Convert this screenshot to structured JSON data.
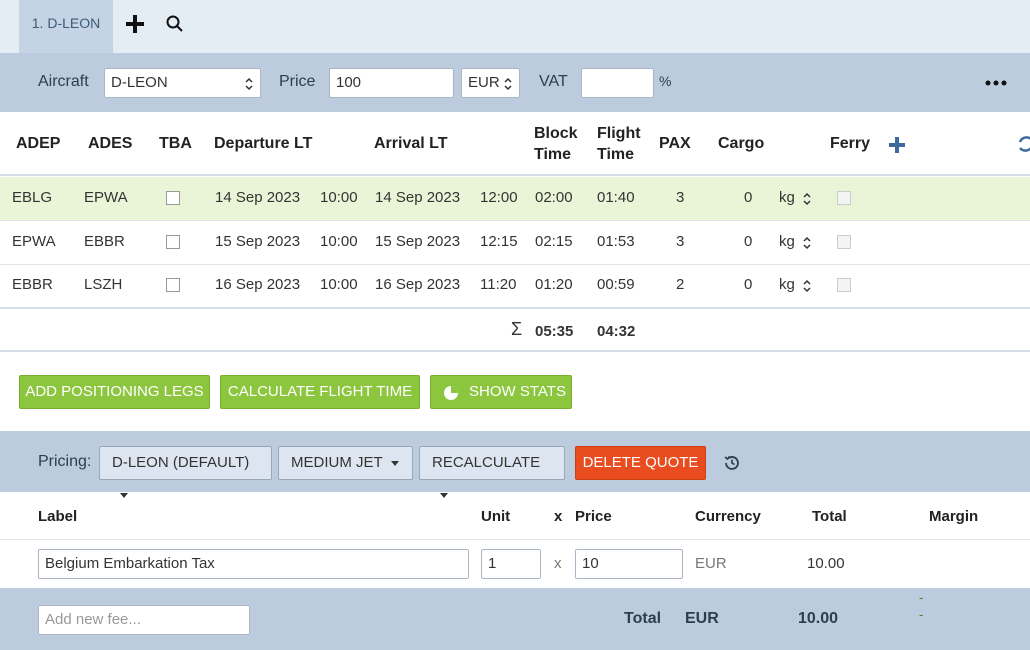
{
  "tabs": {
    "active_label": "1. D-LEON"
  },
  "aircraft_bar": {
    "aircraft_label": "Aircraft",
    "aircraft_value": "D-LEON",
    "price_label": "Price",
    "price_value": "100",
    "currency_value": "EUR",
    "vat_label": "VAT",
    "vat_value": "",
    "vat_suffix": "%"
  },
  "legs": {
    "headers": {
      "adep": "ADEP",
      "ades": "ADES",
      "tba": "TBA",
      "departure": "Departure LT",
      "arrival": "Arrival LT",
      "block_1": "Block",
      "block_2": "Time",
      "flight_1": "Flight",
      "flight_2": "Time",
      "pax": "PAX",
      "cargo": "Cargo",
      "ferry": "Ferry"
    },
    "rows": [
      {
        "adep": "EBLG",
        "ades": "EPWA",
        "dep_date": "14 Sep 2023",
        "dep_time": "10:00",
        "arr_date": "14 Sep 2023",
        "arr_time": "12:00",
        "block": "02:00",
        "flight": "01:40",
        "pax": "3",
        "cargo": "0",
        "unit": "kg",
        "tba": false,
        "ferry": false
      },
      {
        "adep": "EPWA",
        "ades": "EBBR",
        "dep_date": "15 Sep 2023",
        "dep_time": "10:00",
        "arr_date": "15 Sep 2023",
        "arr_time": "12:15",
        "block": "02:15",
        "flight": "01:53",
        "pax": "3",
        "cargo": "0",
        "unit": "kg",
        "tba": false,
        "ferry": false
      },
      {
        "adep": "EBBR",
        "ades": "LSZH",
        "dep_date": "16 Sep 2023",
        "dep_time": "10:00",
        "arr_date": "16 Sep 2023",
        "arr_time": "11:20",
        "block": "01:20",
        "flight": "00:59",
        "pax": "2",
        "cargo": "0",
        "unit": "kg",
        "tba": false,
        "ferry": false
      }
    ],
    "sum_symbol": "Σ",
    "sum_block": "05:35",
    "sum_flight": "04:32"
  },
  "actions": {
    "add_positioning": "ADD POSITIONING LEGS",
    "calculate_flight_time": "CALCULATE FLIGHT TIME",
    "show_stats": "SHOW STATS"
  },
  "pricing": {
    "label": "Pricing:",
    "profile": "D-LEON (DEFAULT)",
    "category": "MEDIUM JET",
    "recalculate": "RECALCULATE",
    "delete": "DELETE QUOTE"
  },
  "fees": {
    "headers": {
      "label": "Label",
      "unit": "Unit",
      "x": "x",
      "price": "Price",
      "currency": "Currency",
      "total": "Total",
      "margin": "Margin"
    },
    "rows": [
      {
        "label": "Belgium Embarkation Tax",
        "unit": "1",
        "x": "x",
        "price": "10",
        "currency": "EUR",
        "total": "10.00"
      }
    ],
    "new_fee_placeholder": "Add new fee...",
    "footer_total_label": "Total",
    "footer_currency": "EUR",
    "footer_total": "10.00",
    "footer_margin_1": "-",
    "footer_margin_2": "-"
  },
  "colors": {
    "accent_green": "#8cc63f",
    "danger_red": "#e84c1f",
    "bar_blue": "#bccbde",
    "selected_row": "#eaf5d8"
  }
}
